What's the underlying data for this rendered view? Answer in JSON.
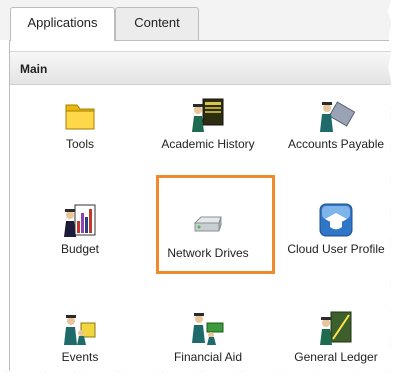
{
  "tabs": [
    {
      "label": "Applications",
      "active": true
    },
    {
      "label": "Content",
      "active": false
    }
  ],
  "section": {
    "title": "Main"
  },
  "apps": [
    {
      "label": "Tools",
      "icon": "folder-icon"
    },
    {
      "label": "Academic History",
      "icon": "academic-history-icon"
    },
    {
      "label": "Accounts Payable",
      "icon": "accounts-payable-icon"
    },
    {
      "label": "Budget",
      "icon": "budget-icon"
    },
    {
      "label": "Network Drives",
      "icon": "network-drive-icon"
    },
    {
      "label": "Cloud User Profile",
      "icon": "cloud-profile-icon"
    },
    {
      "label": "Events",
      "icon": "events-icon"
    },
    {
      "label": "Financial Aid",
      "icon": "financial-aid-icon"
    },
    {
      "label": "General Ledger",
      "icon": "general-ledger-icon"
    }
  ],
  "colors": {
    "highlight": "#f08a2a",
    "tab_bg": "#f3f3f3",
    "header_bg": "#e4e4e4"
  }
}
